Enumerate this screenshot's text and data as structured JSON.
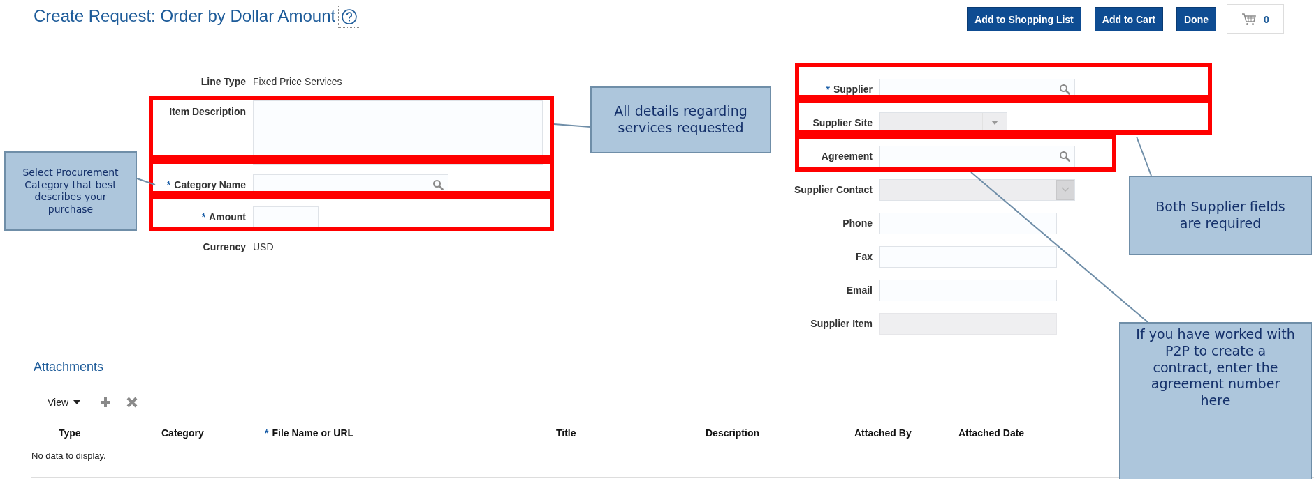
{
  "header": {
    "title": "Create Request: Order by Dollar Amount",
    "buttons": [
      "Add to Shopping List",
      "Add to Cart",
      "Done"
    ],
    "cart_count": "0"
  },
  "left_fields": [
    {
      "label": "Line Type",
      "kind": "static",
      "value": "Fixed Price Services"
    },
    {
      "label": "Item Description",
      "kind": "textarea"
    },
    {
      "label": "Category Name",
      "kind": "search",
      "mark": "*"
    },
    {
      "label": "Amount",
      "kind": "short",
      "mark": "*"
    },
    {
      "label": "Currency",
      "kind": "static",
      "value": "USD"
    }
  ],
  "right_fields": [
    {
      "label": "Supplier",
      "kind": "search",
      "mark": "*"
    },
    {
      "label": "Supplier Site",
      "kind": "dropdown"
    },
    {
      "label": "Agreement",
      "kind": "search"
    },
    {
      "label": "Supplier Contact",
      "kind": "combo"
    },
    {
      "label": "Phone",
      "kind": "input"
    },
    {
      "label": "Fax",
      "kind": "input"
    },
    {
      "label": "Email",
      "kind": "input"
    },
    {
      "label": "Supplier Item",
      "kind": "readonly"
    }
  ],
  "attachments": {
    "title": "Attachments",
    "view_label": "View",
    "columns": [
      {
        "label": "Type"
      },
      {
        "label": "Category"
      },
      {
        "label": "File Name or URL",
        "mark": "*"
      },
      {
        "label": "Title"
      },
      {
        "label": "Description"
      },
      {
        "label": "Attached By"
      },
      {
        "label": "Attached Date"
      }
    ],
    "empty_message": "No data to display."
  },
  "annotations": [
    {
      "text": "All details regarding services requested"
    },
    {
      "text": "Select Procurement Category that best describes your purchase"
    },
    {
      "text": "Both Supplier fields are required"
    },
    {
      "text": "If you have worked with P2P to create a contract, enter the agreement number here"
    }
  ]
}
